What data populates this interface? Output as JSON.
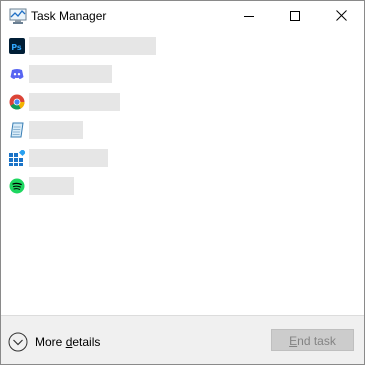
{
  "window": {
    "title": "Task Manager"
  },
  "processes": [
    {
      "icon": "photoshop-icon",
      "name_bar_fraction": 1.0
    },
    {
      "icon": "discord-icon",
      "name_bar_fraction": 0.65
    },
    {
      "icon": "chrome-icon",
      "name_bar_fraction": 0.72
    },
    {
      "icon": "notepad-icon",
      "name_bar_fraction": 0.42
    },
    {
      "icon": "calculator-app-icon",
      "name_bar_fraction": 0.62
    },
    {
      "icon": "spotify-icon",
      "name_bar_fraction": 0.35
    }
  ],
  "footer": {
    "more_details_prefix": "More ",
    "more_details_accel": "d",
    "more_details_suffix": "etails",
    "end_task_accel": "E",
    "end_task_suffix": "nd task",
    "end_task_enabled": false
  },
  "colors": {
    "photoshop_bg": "#001e36",
    "photoshop_fg": "#31a8ff",
    "discord": "#5865f2",
    "spotify": "#1ed760",
    "end_task_bg": "#cccccc",
    "placeholder": "#e6e6e6"
  }
}
